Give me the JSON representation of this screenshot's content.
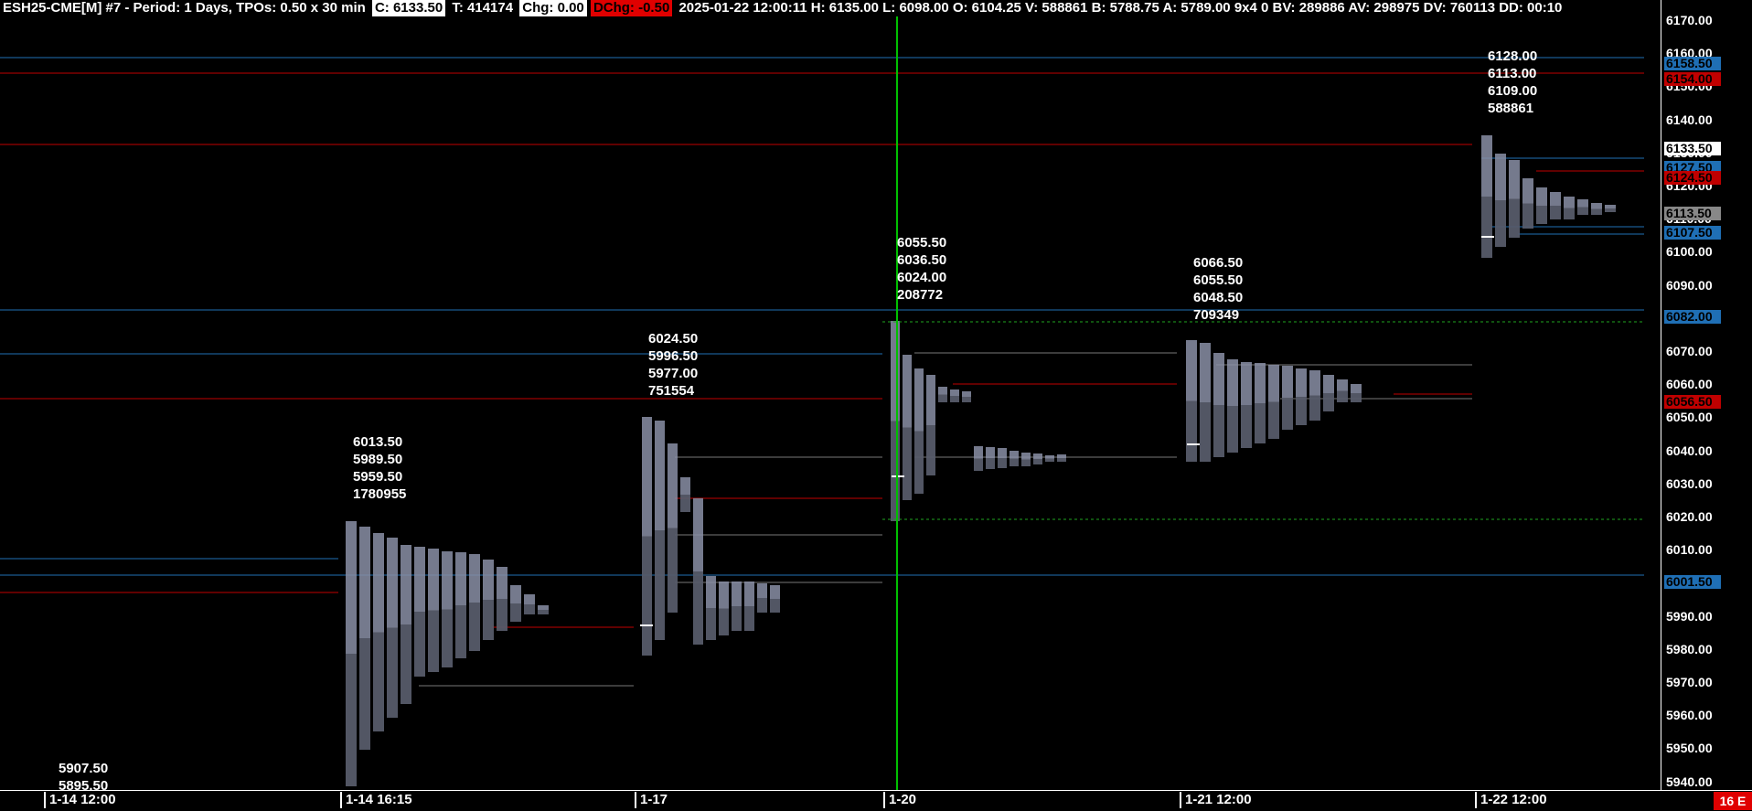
{
  "header": {
    "title": "ESH25-CME[M] #7 - Period: 1 Days, TPOs: 0.50 x 30 min",
    "close": "C: 6133.50",
    "ticks": "T: 414174",
    "chg": "Chg: 0.00",
    "dchg": "DChg: -0.50",
    "details": "2025-01-22 12:00:11 H: 6135.00 L: 6098.00 O: 6104.25 V: 588861 B: 5788.75 A: 5789.00 9x4 0 BV: 289886 AV: 298975 DV: 760113 DD: 00:10"
  },
  "yaxis": {
    "ticks": [
      "6170.00",
      "6160.00",
      "6150.00",
      "6140.00",
      "6130.00",
      "6120.00",
      "6110.00",
      "6100.00",
      "6090.00",
      "6080.00",
      "6070.00",
      "6060.00",
      "6050.00",
      "6040.00",
      "6030.00",
      "6020.00",
      "6010.00",
      "6000.00",
      "5990.00",
      "5980.00",
      "5970.00",
      "5960.00",
      "5950.00",
      "5940.00"
    ],
    "tags": [
      {
        "label": "6158.50",
        "color": "blue"
      },
      {
        "label": "6154.00",
        "color": "red"
      },
      {
        "label": "6133.50",
        "color": "white"
      },
      {
        "label": "6127.50",
        "color": "blue"
      },
      {
        "label": "6124.50",
        "color": "red"
      },
      {
        "label": "6113.50",
        "color": "gray"
      },
      {
        "label": "6107.50",
        "color": "blue"
      },
      {
        "label": "6082.00",
        "color": "blue"
      },
      {
        "label": "6056.50",
        "color": "red"
      },
      {
        "label": "6001.50",
        "color": "blue"
      }
    ]
  },
  "xaxis": {
    "labels": [
      "1-14  12:00",
      "1-14  16:15",
      "1-17",
      "1-20",
      "1-21  12:00",
      "1-22  12:00"
    ]
  },
  "stats": [
    {
      "lines": [
        "5907.50",
        "5895.50"
      ]
    },
    {
      "lines": [
        "6013.50",
        "5989.50",
        "5959.50",
        "1780955"
      ]
    },
    {
      "lines": [
        "6024.50",
        "5996.50",
        "5977.00",
        "751554"
      ]
    },
    {
      "lines": [
        "6055.50",
        "6036.50",
        "6024.00",
        "208772"
      ]
    },
    {
      "lines": [
        "6066.50",
        "6055.50",
        "6048.50",
        "709349"
      ]
    },
    {
      "lines": [
        "6128.00",
        "6113.00",
        "6109.00",
        "588861"
      ]
    }
  ],
  "corner_badge": "16 E",
  "colors": {
    "background": "#000000",
    "profile": "#8a8fa6",
    "profile_dark": "#3a3d4a",
    "poc_line": "#c00000",
    "va_line": "#1f6fb5",
    "cursor": "#00c000"
  }
}
